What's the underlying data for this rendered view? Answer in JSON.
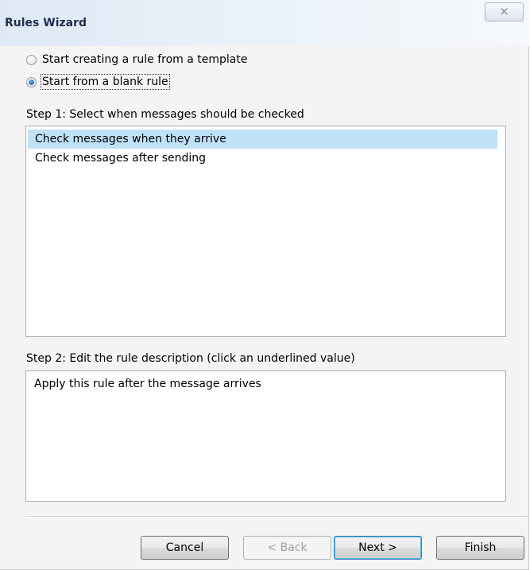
{
  "window": {
    "title": "Rules Wizard",
    "close_glyph": "⨯"
  },
  "options": [
    {
      "label": "Start creating a rule from a template",
      "checked": false
    },
    {
      "label": "Start from a blank rule",
      "checked": true
    }
  ],
  "step1": {
    "label": "Step 1: Select when messages should be checked",
    "items": [
      "Check messages when they arrive",
      "Check messages after sending"
    ],
    "selected_index": 0
  },
  "step2": {
    "label": "Step 2: Edit the rule description (click an underlined value)",
    "description": "Apply this rule after the message arrives"
  },
  "buttons": {
    "cancel": "Cancel",
    "back": "< Back",
    "next": "Next >",
    "finish": "Finish"
  },
  "icons": {
    "close": "close-icon",
    "radio": "radio-button"
  },
  "colors": {
    "selection": "#bfe2f7",
    "title_text": "#1d2e4f"
  }
}
